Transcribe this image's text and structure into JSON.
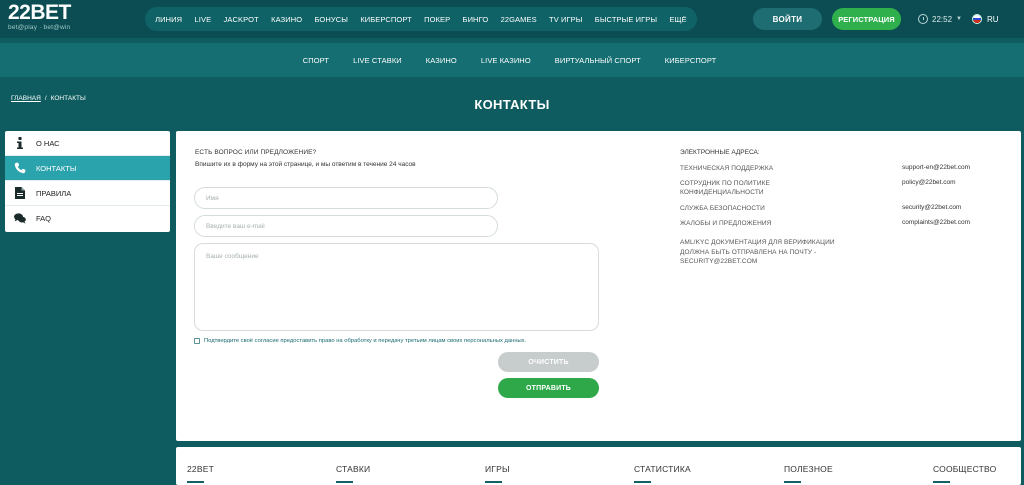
{
  "header": {
    "logo": {
      "number": "22",
      "text": "BET",
      "tagline": "bet@play · bet@win"
    },
    "nav": [
      "ЛИНИЯ",
      "LIVE",
      "JACKPOT",
      "КАЗИНО",
      "БОНУСЫ",
      "КИБЕРСПОРТ",
      "ПОКЕР",
      "БИНГО",
      "22GAMES",
      "TV ИГРЫ",
      "БЫСТРЫЕ ИГРЫ",
      "ЕЩЁ"
    ],
    "login_label": "ВОЙТИ",
    "register_label": "РЕГИСТРАЦИЯ",
    "time": "22:52",
    "language": "RU"
  },
  "subnav": [
    "СПОРТ",
    "LIVE СТАВКИ",
    "КАЗИНО",
    "LIVE КАЗИНО",
    "ВИРТУАЛЬНЫЙ СПОРТ",
    "КИБЕРСПОРТ"
  ],
  "breadcrumb": {
    "home": "ГЛАВНАЯ",
    "separator": "/",
    "current": "КОНТАКТЫ"
  },
  "page_title": "КОНТАКТЫ",
  "sidebar": [
    {
      "label": "О НАС",
      "icon": "info-icon"
    },
    {
      "label": "КОНТАКТЫ",
      "icon": "phone-icon"
    },
    {
      "label": "ПРАВИЛА",
      "icon": "document-icon"
    },
    {
      "label": "FAQ",
      "icon": "chat-icon"
    }
  ],
  "form": {
    "title": "ЕСТЬ ВОПРОС ИЛИ ПРЕДЛОЖЕНИЕ?",
    "subtitle": "Впишите их в форму на этой странице, и мы ответим в течение 24 часов",
    "name_placeholder": "Имя",
    "email_placeholder": "Введите ваш e-mail",
    "message_placeholder": "Ваше сообщение",
    "consent": "Подтвердите своё согласие предоставить право на обработку и передачу третьим лицам своих персональных данных.",
    "clear_label": "ОЧИСТИТЬ",
    "send_label": "ОТПРАВИТЬ"
  },
  "emails": {
    "heading": "ЭЛЕКТРОННЫЕ АДРЕСА:",
    "rows": [
      {
        "label": "ТЕХНИЧЕСКАЯ ПОДДЕРЖКА",
        "value": "support-en@22bet.com"
      },
      {
        "label": "СОТРУДНИК ПО ПОЛИТИКЕ КОНФИДЕНЦИАЛЬНОСТИ",
        "value": "policy@22bet.com"
      },
      {
        "label": "СЛУЖБА БЕЗОПАСНОСТИ",
        "value": "security@22bet.com"
      },
      {
        "label": "ЖАЛОБЫ И ПРЕДЛОЖЕНИЯ",
        "value": "complaints@22bet.com"
      }
    ],
    "aml_note": "AML/KYC ДОКУМЕНТАЦИЯ ДЛЯ ВЕРИФИКАЦИИ ДОЛЖНА БЫТЬ ОТПРАВЛЕНА НА ПОЧТУ - SECURITY@22BET.COM"
  },
  "footer": [
    "22BET",
    "СТАВКИ",
    "ИГРЫ",
    "СТАТИСТИКА",
    "ПОЛЕЗНОЕ",
    "СООБЩЕСТВО"
  ],
  "colors": {
    "background": "#0e5c60",
    "header": "#0b4d52",
    "accent_green": "#2fb04c",
    "sidebar_active": "#2aa3ad"
  }
}
